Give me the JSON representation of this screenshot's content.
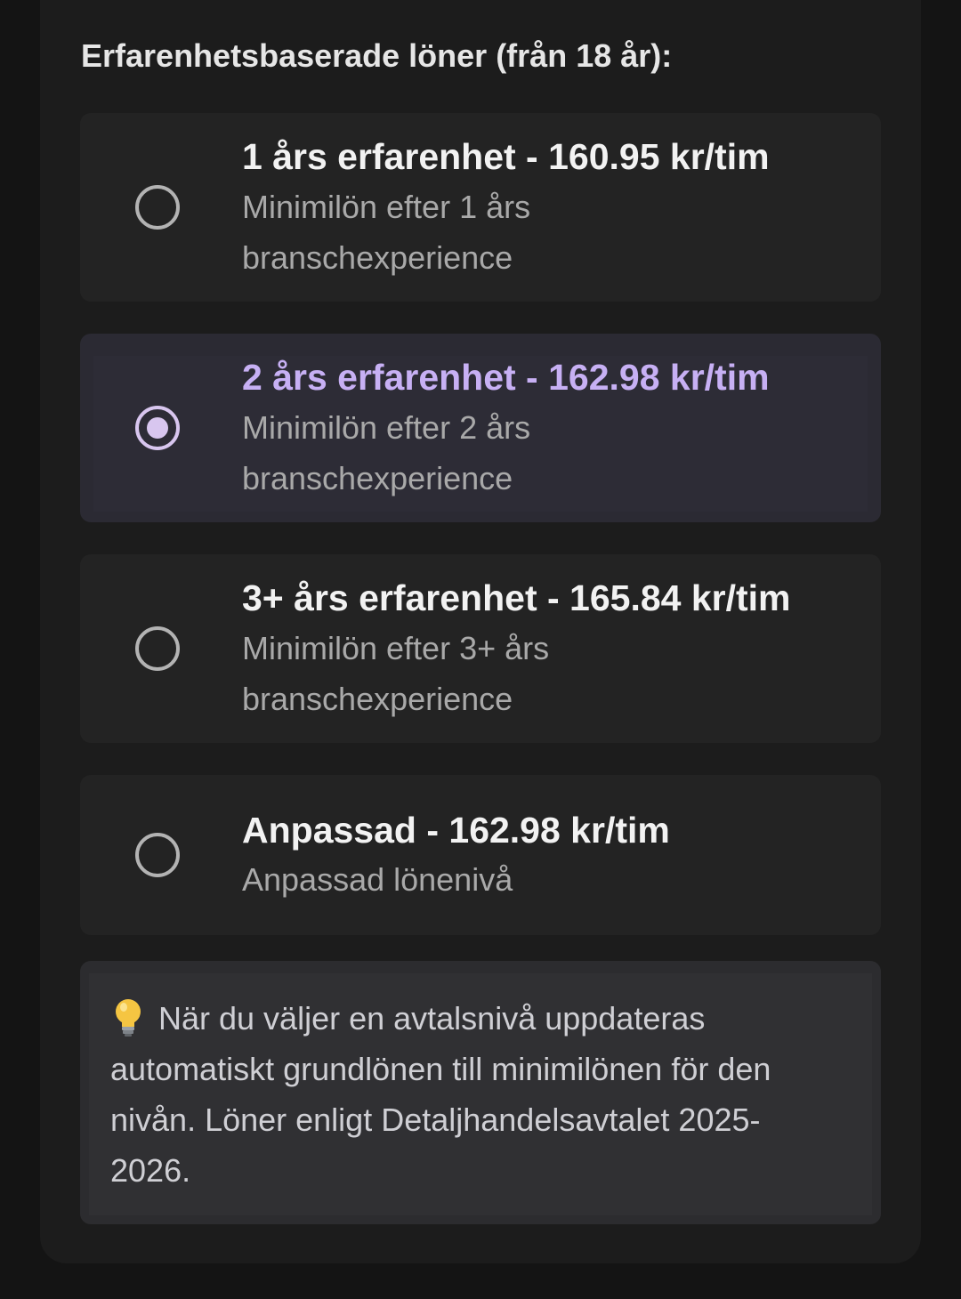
{
  "section": {
    "title": "Erfarenhetsbaserade löner (från 18 år):"
  },
  "options": [
    {
      "title": "1 års erfarenhet - 160.95 kr/tim",
      "subtitle": "Minimilön efter 1 års branschexperience",
      "selected": false
    },
    {
      "title": "2 års erfarenhet - 162.98 kr/tim",
      "subtitle": "Minimilön efter 2 års branschexperience",
      "selected": true
    },
    {
      "title": "3+ års erfarenhet - 165.84 kr/tim",
      "subtitle": "Minimilön efter 3+ års branschexperience",
      "selected": false
    },
    {
      "title": "Anpassad - 162.98 kr/tim",
      "subtitle": "Anpassad lönenivå",
      "selected": false
    }
  ],
  "info": {
    "icon": "lightbulb-icon",
    "text": "När du väljer en avtalsnivå uppdateras automatiskt grundlönen till minimilönen för den nivån. Löner enligt Detaljhandelsavtalet 2025-2026."
  },
  "colors": {
    "accent": "#c7b0f4",
    "radio_selected": "#d8c6ef",
    "background": "#141414"
  }
}
